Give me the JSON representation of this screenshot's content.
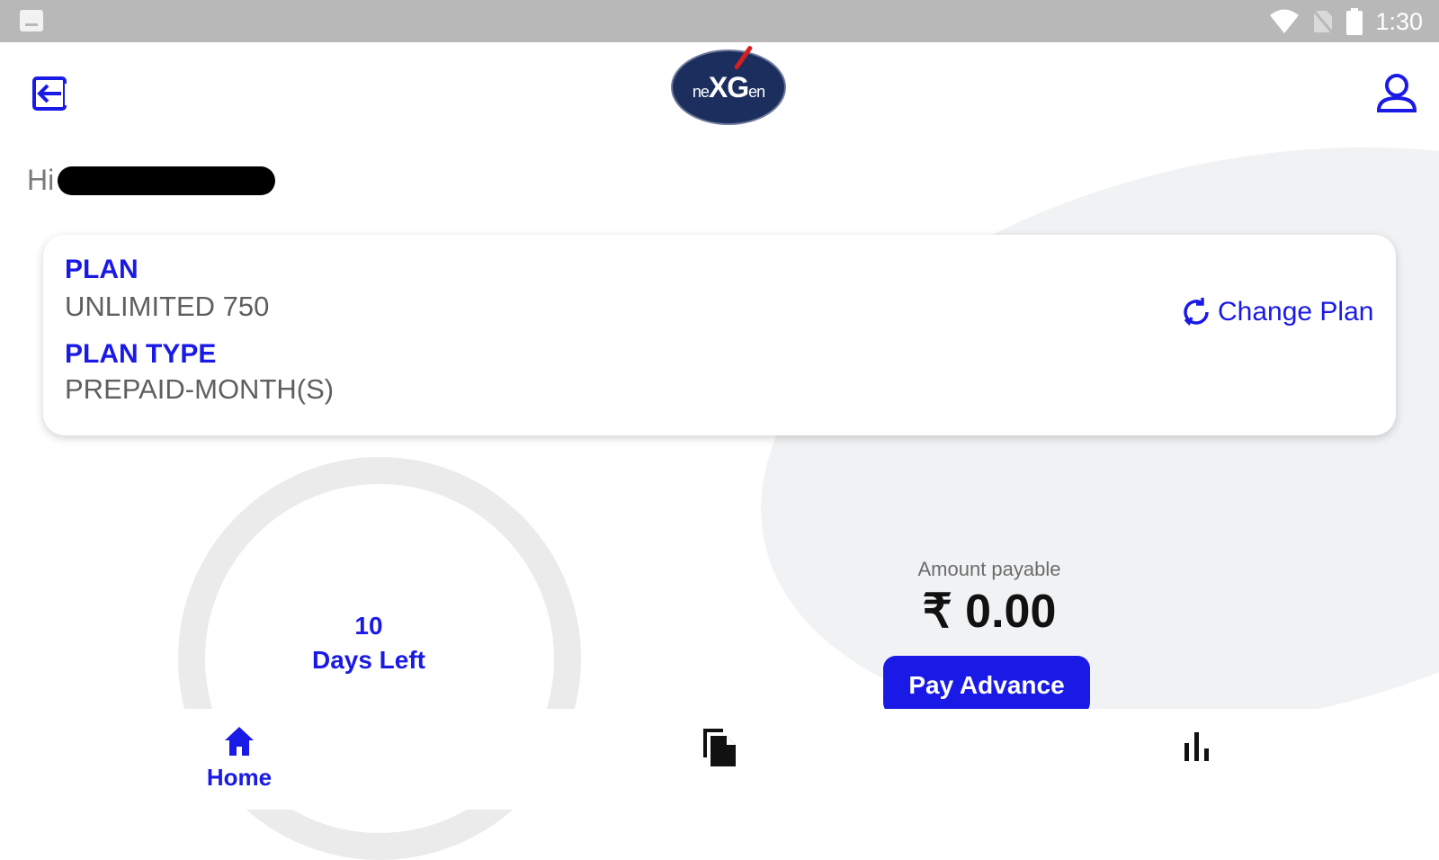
{
  "status_bar": {
    "time": "1:30",
    "icons": [
      "image-notification-icon",
      "wifi-icon",
      "no-sim-icon",
      "battery-icon"
    ]
  },
  "header": {
    "logo_text_prefix": "ne",
    "logo_text_main": "XG",
    "logo_text_suffix": "en",
    "left_icon": "logout-icon",
    "right_icon": "user-profile-icon"
  },
  "greeting": {
    "prefix": "Hi"
  },
  "plan_card": {
    "plan_label": "PLAN",
    "plan_value": "UNLIMITED 750",
    "plan_type_label": "PLAN TYPE",
    "plan_type_value": "PREPAID-MONTH(S)",
    "change_plan_label": "Change Plan",
    "change_plan_icon": "refresh-icon"
  },
  "days_left": {
    "number": "10",
    "label": "Days Left"
  },
  "amount": {
    "label": "Amount payable",
    "value": "₹ 0.00",
    "button_label": "Pay Advance"
  },
  "bottom_nav": {
    "items": [
      {
        "label": "Home",
        "icon": "home-icon",
        "active": true
      },
      {
        "label": "",
        "icon": "documents-icon",
        "active": false
      },
      {
        "label": "",
        "icon": "bar-chart-icon",
        "active": false
      }
    ]
  },
  "colors": {
    "accent": "#1a1ae6",
    "status_bar": "#b8b8b8",
    "logo_bg": "#1b2e5e",
    "background_shape": "#f1f2f4"
  }
}
